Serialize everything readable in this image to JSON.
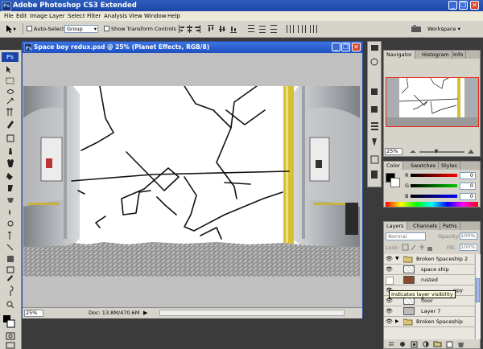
{
  "app": {
    "title": "Adobe Photoshop CS3 Extended",
    "logo": "Ps",
    "window_controls": [
      "_",
      "❐",
      "✕"
    ]
  },
  "menu": [
    "File",
    "Edit",
    "Image",
    "Layer",
    "Select",
    "Filter",
    "Analysis",
    "View",
    "Window",
    "Help"
  ],
  "options_bar": {
    "auto_select_label": "Auto-Select:",
    "auto_select_value": "Group",
    "show_transform_label": "Show Transform Controls",
    "workspace_label": "Workspace ▾"
  },
  "document": {
    "title": "Space boy redux.psd @ 25% (Planet Effects, RGB/8)",
    "zoom": "25%",
    "doc_info": "Doc: 13.8M/470.6M"
  },
  "navigator": {
    "tabs": [
      "Navigator",
      "Histogram",
      "Info"
    ],
    "zoom": "25%"
  },
  "color_panel": {
    "tabs": [
      "Color",
      "Swatches",
      "Styles"
    ],
    "channels": [
      {
        "label": "R",
        "value": "0"
      },
      {
        "label": "G",
        "value": "0"
      },
      {
        "label": "B",
        "value": "0"
      }
    ]
  },
  "layers_panel": {
    "tabs": [
      "Layers",
      "Channels",
      "Paths"
    ],
    "blend_mode": "Normal",
    "opacity_label": "Opacity:",
    "opacity_value": "100%",
    "lock_label": "Lock:",
    "fill_label": "Fill:",
    "fill_value": "100%",
    "tooltip": "Indicates layer visibility",
    "layers": [
      {
        "name": "Broken Spaceship 2",
        "type": "group"
      },
      {
        "name": "space ship",
        "type": "layer"
      },
      {
        "name": "rusted",
        "type": "layer"
      },
      {
        "name": "opy",
        "type": "layer"
      },
      {
        "name": "floor",
        "type": "layer"
      },
      {
        "name": "Layer 7",
        "type": "layer"
      },
      {
        "name": "Broken Spaceship",
        "type": "group"
      }
    ]
  },
  "colors": {
    "titlebar": "#1d45a8",
    "chrome": "#d6d3ca",
    "pole": "#d7c133",
    "red": "#d9442b"
  }
}
